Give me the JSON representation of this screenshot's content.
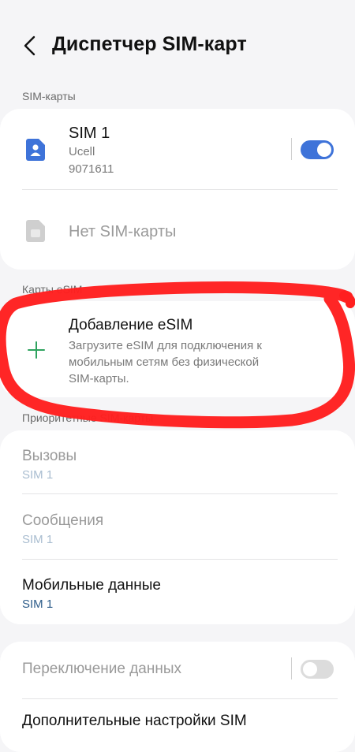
{
  "header": {
    "title": "Диспетчер SIM-карт"
  },
  "sections": {
    "sim_cards_label": "SIM-карты",
    "esim_label": "Карты eSIM",
    "priority_label": "Приоритетные SIM-карты"
  },
  "sim_cards": {
    "sim1": {
      "title": "SIM 1",
      "operator": "Ucell",
      "number": "9071611",
      "enabled": true
    },
    "sim2": {
      "title": "Нет SIM-карты"
    }
  },
  "esim": {
    "add_title": "Добавление eSIM",
    "add_description_line1": "Загрузите eSIM для подключения к",
    "add_description_line2": "мобильным сетям без физической",
    "add_description_line3": "SIM-карты."
  },
  "priority": {
    "calls": {
      "title": "Вызовы",
      "value": "SIM 1"
    },
    "messages": {
      "title": "Сообщения",
      "value": "SIM 1"
    },
    "mobile_data": {
      "title": "Мобильные данные",
      "value": "SIM 1"
    }
  },
  "more": {
    "data_switching": {
      "title": "Переключение данных",
      "enabled": false
    },
    "additional_settings": {
      "title": "Дополнительные настройки SIM"
    }
  },
  "colors": {
    "accent": "#3e73d9",
    "annotation_red": "#ff1f1f",
    "plus_green": "#2fa35f"
  }
}
